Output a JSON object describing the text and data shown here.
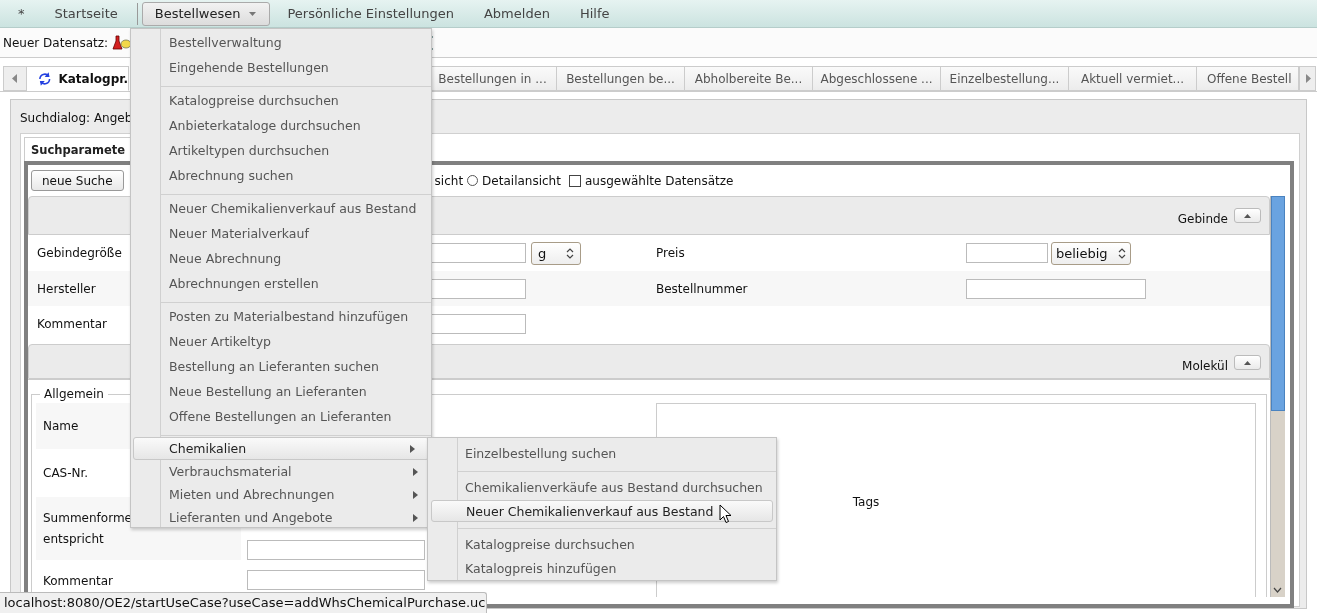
{
  "menubar": [
    {
      "label": "*",
      "selected": false,
      "dropdown": false
    },
    {
      "label": "Startseite",
      "selected": false,
      "dropdown": false
    },
    {
      "label": "Bestellwesen",
      "selected": true,
      "dropdown": true
    },
    {
      "label": "Persönliche Einstellungen",
      "selected": false,
      "dropdown": false
    },
    {
      "label": "Abmelden",
      "selected": false,
      "dropdown": false
    },
    {
      "label": "Hilfe",
      "selected": false,
      "dropdown": false
    }
  ],
  "toolbar": {
    "label": "Neuer Datensatz:"
  },
  "tabs": [
    {
      "label": "Katalogpr.",
      "selected": true
    },
    {
      "label": "Bestellungen in ...",
      "selected": false
    },
    {
      "label": "Bestellungen be...",
      "selected": false
    },
    {
      "label": "Abholbereite Be...",
      "selected": false
    },
    {
      "label": "Abgeschlossene ...",
      "selected": false
    },
    {
      "label": "Einzelbestellung...",
      "selected": false
    },
    {
      "label": "Aktuell vermiet...",
      "selected": false
    },
    {
      "label": "Offene Bestell",
      "selected": false
    }
  ],
  "dialog_title": "Suchdialog: Angeb",
  "inner_tab": {
    "label": "Suchparamete",
    "selected": true
  },
  "search_bar": {
    "button": "neue Suche",
    "view_fragment": "sicht",
    "radio": {
      "label": "Detailansicht",
      "selected": false
    },
    "checkbox": {
      "label": "ausgewählte Datensätze",
      "checked": false
    }
  },
  "gebinde": {
    "title": "Gebinde",
    "expanded": true,
    "rows": [
      {
        "label": "Gebindegröße",
        "unit": "g",
        "label_2": "Preis",
        "select_2": "beliebig"
      },
      {
        "label": "Hersteller",
        "label_2": "Bestellnummer"
      },
      {
        "label": "Kommentar"
      }
    ]
  },
  "molekuel": {
    "title": "Molekül",
    "expanded": true,
    "group": "Allgemein",
    "rows": [
      {
        "label": "Name"
      },
      {
        "label": "CAS-Nr."
      },
      {
        "label": "Summenforme\nentspricht",
        "input": true
      },
      {
        "label": "Kommentar",
        "input": true
      }
    ],
    "tags_label": "Tags"
  },
  "menu": {
    "items": [
      {
        "kind": "item",
        "label": "Bestellverwaltung",
        "selected": false
      },
      {
        "kind": "item",
        "label": "Eingehende Bestellungen",
        "selected": false
      },
      {
        "kind": "separator"
      },
      {
        "kind": "item",
        "label": "Katalogpreise durchsuchen",
        "selected": false
      },
      {
        "kind": "item",
        "label": "Anbieterkataloge durchsuchen",
        "selected": false
      },
      {
        "kind": "item",
        "label": "Artikeltypen durchsuchen",
        "selected": false
      },
      {
        "kind": "item",
        "label": "Abrechnung suchen",
        "selected": false
      },
      {
        "kind": "separator"
      },
      {
        "kind": "item",
        "label": "Neuer Chemikalienverkauf aus Bestand",
        "selected": false
      },
      {
        "kind": "item",
        "label": "Neuer Materialverkauf",
        "selected": false
      },
      {
        "kind": "item",
        "label": "Neue Abrechnung",
        "selected": false
      },
      {
        "kind": "item",
        "label": "Abrechnungen erstellen",
        "selected": false
      },
      {
        "kind": "separator"
      },
      {
        "kind": "item",
        "label": "Posten zu Materialbestand hinzufügen",
        "selected": false
      },
      {
        "kind": "item",
        "label": "Neuer Artikeltyp",
        "selected": false
      },
      {
        "kind": "item",
        "label": "Bestellung an Lieferanten suchen",
        "selected": false
      },
      {
        "kind": "item",
        "label": "Neue Bestellung an Lieferanten",
        "selected": false
      },
      {
        "kind": "item",
        "label": "Offene Bestellungen an Lieferanten",
        "selected": false
      },
      {
        "kind": "separator"
      },
      {
        "kind": "submenu",
        "label": "Chemikalien",
        "selected": true
      },
      {
        "kind": "submenu",
        "label": "Verbrauchsmaterial",
        "selected": false
      },
      {
        "kind": "submenu",
        "label": "Mieten und Abrechnungen",
        "selected": false
      },
      {
        "kind": "submenu",
        "label": "Lieferanten und Angebote",
        "selected": false
      }
    ]
  },
  "submenu": {
    "items": [
      {
        "kind": "item",
        "label": "Einzelbestellung suchen",
        "selected": false
      },
      {
        "kind": "separator"
      },
      {
        "kind": "item",
        "label": "Chemikalienverkäufe aus Bestand durchsuchen",
        "selected": false
      },
      {
        "kind": "item",
        "label": "Neuer Chemikalienverkauf aus Bestand",
        "selected": true
      },
      {
        "kind": "separator"
      },
      {
        "kind": "item",
        "label": "Katalogpreise durchsuchen",
        "selected": false
      },
      {
        "kind": "item",
        "label": "Katalogpreis hinzufügen",
        "selected": false
      }
    ]
  },
  "status_bar": "localhost:8080/OE2/startUseCase?useCase=addWhsChemicalPurchase.uc"
}
